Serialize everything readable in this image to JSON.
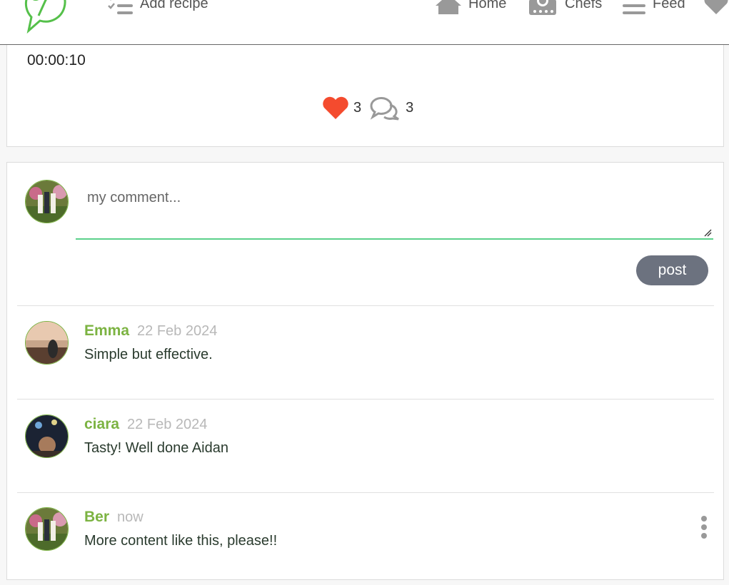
{
  "nav": {
    "add_recipe": "Add recipe",
    "home": "Home",
    "chefs": "Chefs",
    "feed": "Feed"
  },
  "recipe": {
    "timer": "00:00:10",
    "likes": "3",
    "comments_count": "3"
  },
  "comment_form": {
    "placeholder": "my comment...",
    "post_label": "post"
  },
  "comments": [
    {
      "author": "Emma",
      "date": "22 Feb 2024",
      "text": "Simple but effective."
    },
    {
      "author": "ciara",
      "date": "22 Feb 2024",
      "text": "Tasty! Well done Aidan"
    },
    {
      "author": "Ber",
      "date": "now",
      "text": "More content like this, please!!"
    }
  ],
  "colors": {
    "accent": "#7cb342",
    "heart": "#f44b2e",
    "post_button": "#6c727f",
    "input_underline": "#5bd18b"
  }
}
